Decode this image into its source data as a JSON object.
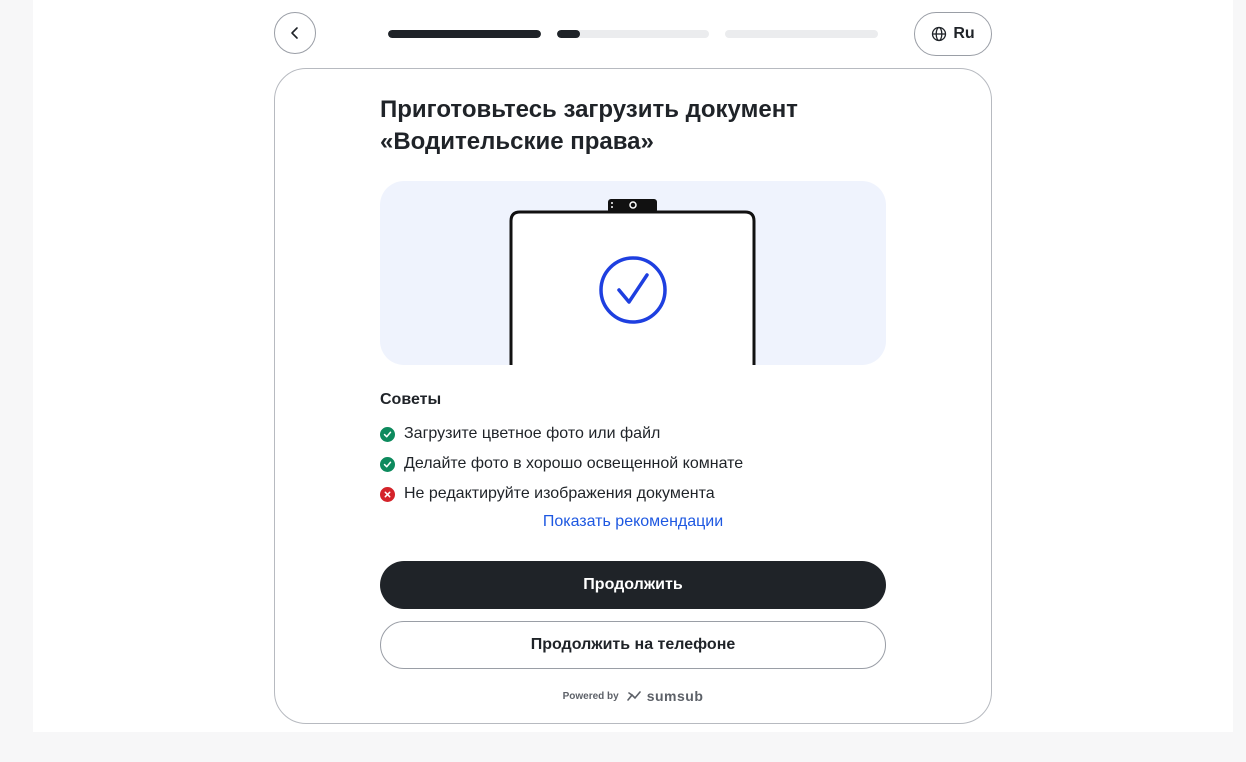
{
  "header": {
    "back_icon": "chevron-left-icon",
    "progress": {
      "segments": [
        {
          "fill": 1.0
        },
        {
          "fill": 0.15
        },
        {
          "fill": 0.0
        }
      ]
    },
    "language": {
      "icon": "globe-icon",
      "label": "Ru"
    }
  },
  "main": {
    "title_line1": "Приготовьтесь загрузить документ",
    "title_line2": "«Водительские права»",
    "illustration_icon": "phone-check-icon",
    "tips": {
      "heading": "Советы",
      "items": [
        {
          "text": "Загрузите цветное фото или файл",
          "status": "ok"
        },
        {
          "text": "Делайте фото в хорошо освещенной комнате",
          "status": "ok"
        },
        {
          "text": "Не редактируйте изображения документа",
          "status": "bad"
        }
      ]
    },
    "show_recommendations": "Показать рекомендации",
    "continue_label": "Продолжить",
    "continue_phone_label": "Продолжить на телефоне"
  },
  "footer": {
    "powered_by": "Powered by",
    "brand": "sumsub"
  },
  "colors": {
    "primary": "#1f2328",
    "accent": "#1e58e1",
    "success": "#0d8a5d",
    "error": "#d4232a",
    "illustration_bg": "#eff3fd"
  }
}
